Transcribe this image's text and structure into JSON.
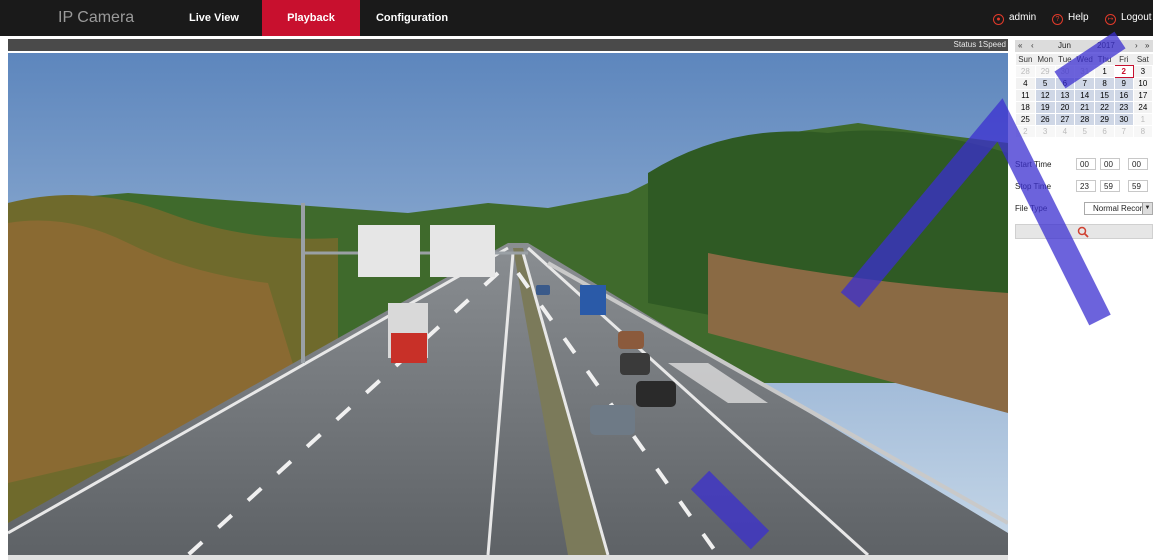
{
  "header": {
    "brand": "IP Camera",
    "tabs": [
      {
        "label": "Live View"
      },
      {
        "label": "Playback"
      },
      {
        "label": "Configuration"
      }
    ],
    "admin": "admin",
    "help": "Help",
    "logout": "Logout"
  },
  "statusbar": {
    "text": "Status 1Speed"
  },
  "calendar": {
    "month": "Jun",
    "year": "2017",
    "weekdays": [
      "Sun",
      "Mon",
      "Tue",
      "Wed",
      "Thu",
      "Fri",
      "Sat"
    ],
    "weeks": [
      [
        "28",
        "29",
        "30",
        "31",
        "1",
        "2",
        "3"
      ],
      [
        "4",
        "5",
        "6",
        "7",
        "8",
        "9",
        "10"
      ],
      [
        "11",
        "12",
        "13",
        "14",
        "15",
        "16",
        "17"
      ],
      [
        "18",
        "19",
        "20",
        "21",
        "22",
        "23",
        "24"
      ],
      [
        "25",
        "26",
        "27",
        "28",
        "29",
        "30",
        "1"
      ],
      [
        "2",
        "3",
        "4",
        "5",
        "6",
        "7",
        "8"
      ]
    ]
  },
  "search": {
    "start_label": "Start Time",
    "start_h": "00",
    "start_m": "00",
    "start_s": "00",
    "stop_label": "Stop Time",
    "stop_h": "23",
    "stop_m": "59",
    "stop_s": "59",
    "filetype_label": "File Type",
    "filetype_value": "Normal Record"
  },
  "colors": {
    "accent": "#c8102e",
    "topbar": "#1a1a1a",
    "statusbar": "#4a4a4a"
  },
  "icons": {
    "search": "search-icon",
    "prev_year": "double-chevron-left-icon",
    "next_year": "double-chevron-right-icon"
  }
}
